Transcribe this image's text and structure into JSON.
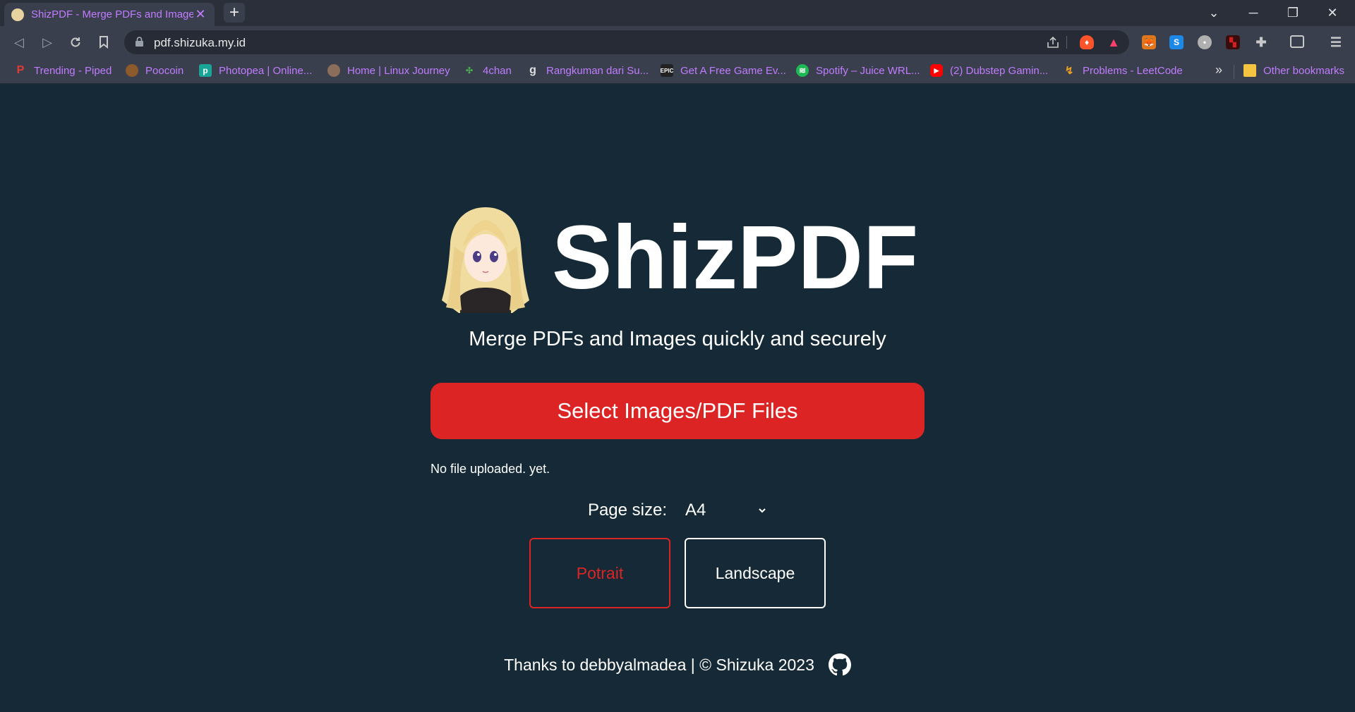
{
  "browser": {
    "tab_title": "ShizPDF - Merge PDFs and Images",
    "url": "pdf.shizuka.my.id",
    "bookmarks": [
      {
        "label": "Trending - Piped",
        "icon": "piped-icon",
        "color": "#e53935"
      },
      {
        "label": "Poocoin",
        "icon": "poocoin-icon",
        "color": "#8d5a2b"
      },
      {
        "label": "Photopea | Online...",
        "icon": "photopea-icon",
        "color": "#18a497"
      },
      {
        "label": "Home | Linux Journey",
        "icon": "linux-journey-icon",
        "color": "#8a6d5a"
      },
      {
        "label": "4chan",
        "icon": "4chan-icon",
        "color": "#2e7d32"
      },
      {
        "label": "Rangkuman dari Su...",
        "icon": "g-icon",
        "color": "#5a5f6a"
      },
      {
        "label": "Get A Free Game Ev...",
        "icon": "epic-icon",
        "color": "#333333"
      },
      {
        "label": "Spotify – Juice WRL...",
        "icon": "spotify-icon",
        "color": "#1db954"
      },
      {
        "label": "(2) Dubstep Gamin...",
        "icon": "youtube-icon",
        "color": "#ff0000"
      },
      {
        "label": "Problems - LeetCode",
        "icon": "leetcode-icon",
        "color": "#f0a020"
      }
    ],
    "more_bookmarks": "»",
    "other_bookmarks": "Other bookmarks"
  },
  "page": {
    "brand": "ShizPDF",
    "subtitle": "Merge PDFs and Images quickly and securely",
    "select_button": "Select Images/PDF Files",
    "status": "No file uploaded. yet.",
    "page_size_label": "Page size:",
    "page_size_value": "A4",
    "orientation": {
      "potrait": "Potrait",
      "landscape": "Landscape",
      "selected": "potrait"
    },
    "footer": "Thanks to debbyalmadea | © Shizuka 2023"
  },
  "colors": {
    "background": "#152a36",
    "accent": "#dc2424",
    "tab_text": "#c07cff"
  }
}
